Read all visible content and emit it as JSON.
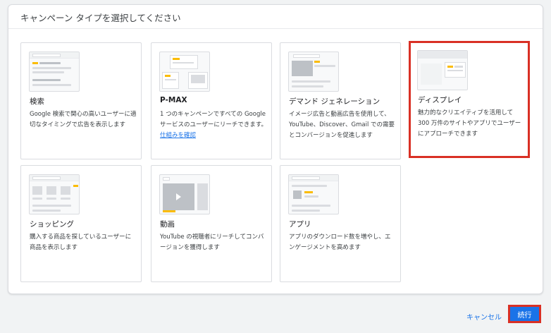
{
  "header": {
    "title": "キャンペーン タイプを選択してください"
  },
  "cards": [
    {
      "title": "検索",
      "desc": "Google 検索で関心の高いユーザーに適切なタイミングで広告を表示します"
    },
    {
      "title": "P-MAX",
      "desc": "1 つのキャンペーンですべての Google サービスのユーザーにリーチできます。",
      "link": "仕組みを確認"
    },
    {
      "title": "デマンド ジェネレーション",
      "desc": "イメージ広告と動画広告を使用して、YouTube、Discover、Gmail での需要とコンバージョンを促進します"
    },
    {
      "title": "ディスプレイ",
      "desc": "魅力的なクリエイティブを活用して 300 万件のサイトやアプリでユーザーにアプローチできます",
      "selected": true
    },
    {
      "title": "ショッピング",
      "desc": "購入する商品を探しているユーザーに商品を表示します"
    },
    {
      "title": "動画",
      "desc": "YouTube の視聴者にリーチしてコンバージョンを獲得します"
    },
    {
      "title": "アプリ",
      "desc": "アプリのダウンロード数を増やし、エンゲージメントを高めます"
    }
  ],
  "footer": {
    "cancel_label": "キャンセル",
    "continue_label": "続行"
  },
  "colors": {
    "accent": "#1a73e8",
    "highlight": "#d93025",
    "thumb_yellow": "#fbbc04"
  }
}
